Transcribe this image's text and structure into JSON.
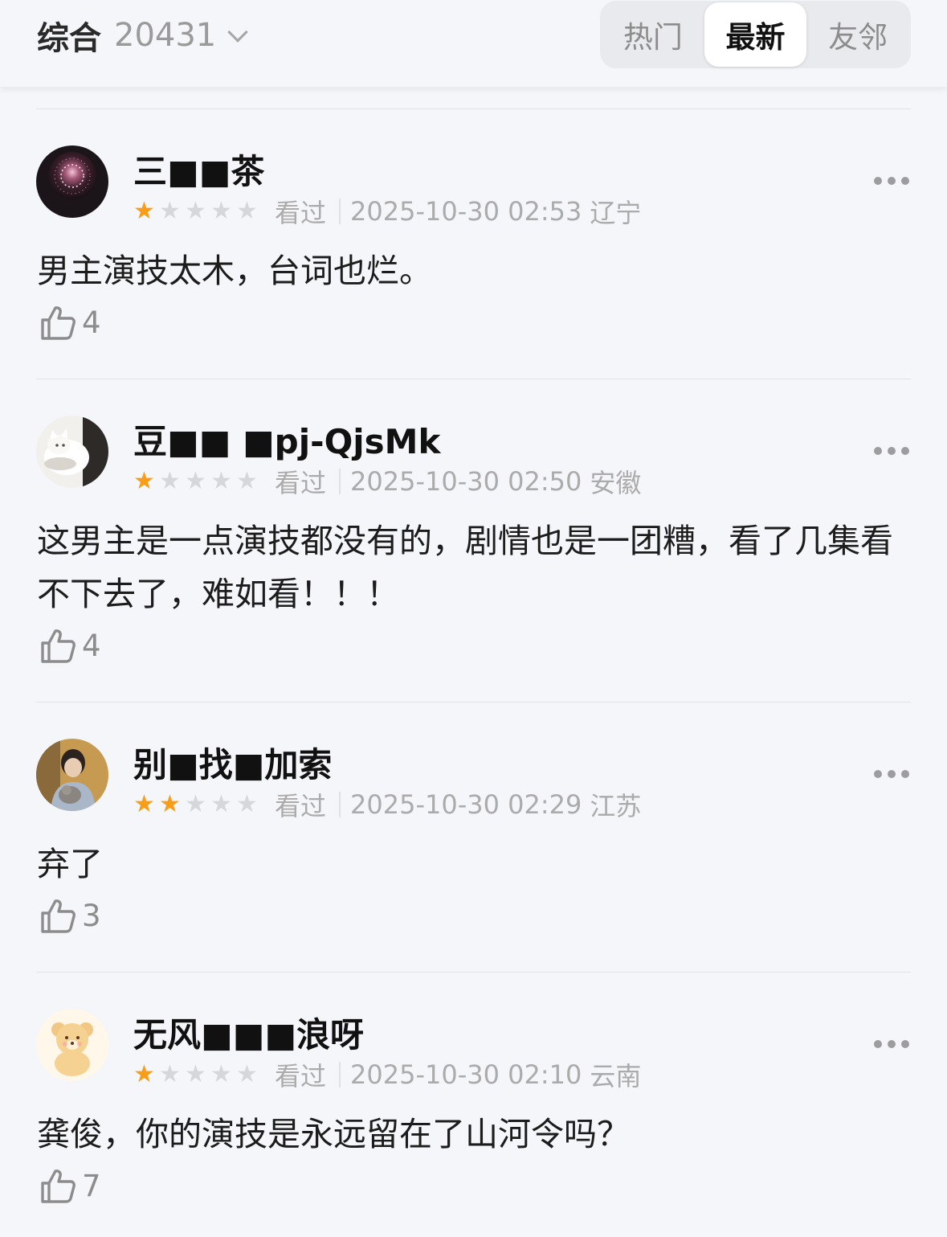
{
  "header": {
    "filter_label": "综合",
    "filter_count": "20431",
    "tabs": [
      {
        "label": "热门",
        "active": false
      },
      {
        "label": "最新",
        "active": true
      },
      {
        "label": "友邻",
        "active": false
      }
    ]
  },
  "colors": {
    "star_active": "#f99d17",
    "star_inactive": "#d6d7db",
    "meta_text": "#ababab",
    "background": "#f5f6fa"
  },
  "comments": [
    {
      "username": "三■■茶",
      "rating": 1,
      "status": "看过",
      "datetime": "2025-10-30 02:53",
      "region": "辽宁",
      "text": "男主演技太木，台词也烂。",
      "likes": "4",
      "avatar_icon": "fireworks-avatar"
    },
    {
      "username": "豆■■ ■pj-QjsMk",
      "rating": 1,
      "status": "看过",
      "datetime": "2025-10-30 02:50",
      "region": "安徽",
      "text": "这男主是一点演技都没有的，剧情也是一团糟，看了几集看不下去了，难如看！！！",
      "likes": "4",
      "avatar_icon": "cat-avatar"
    },
    {
      "username": "别■找■加索",
      "rating": 2,
      "status": "看过",
      "datetime": "2025-10-30 02:29",
      "region": "江苏",
      "text": "弃了",
      "likes": "3",
      "avatar_icon": "person-with-cat-avatar"
    },
    {
      "username": "无风■■■浪呀",
      "rating": 1,
      "status": "看过",
      "datetime": "2025-10-30 02:10",
      "region": "云南",
      "text": "龚俊，你的演技是永远留在了山河令吗？",
      "likes": "7",
      "avatar_icon": "teddy-bear-avatar"
    }
  ]
}
